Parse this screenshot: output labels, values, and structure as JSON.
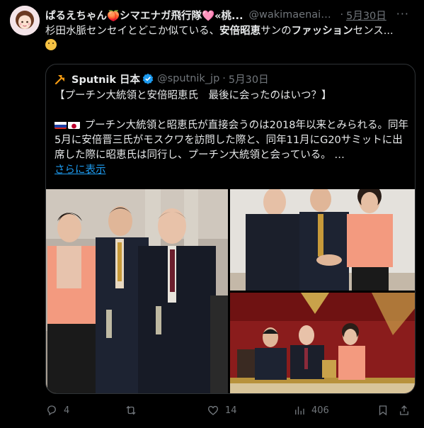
{
  "author": {
    "name": "ぱるえちゃん🍑シマエナガ飛行隊🩷«桃...",
    "handle": "@wakimaenaipa...",
    "separator": "·",
    "date": "5月30日"
  },
  "tweet": {
    "text_part1": "杉田水脈センセイとどこか似ている、",
    "text_bold1": "安倍昭恵",
    "text_part2": "サンの",
    "text_bold2": "ファッション",
    "text_part3": "センス...",
    "emoji": "thinking-face-emoji"
  },
  "quoted": {
    "name": "Sputnik 日本",
    "handle": "@sputnik_jp",
    "separator": "·",
    "date": "5月30日",
    "title": "【プーチン大統領と安倍昭恵氏　最後に会ったのはいつ？】",
    "body": "プーチン大統領と昭恵氏が直接会うのは2018年以来とみられる。同年5月に安倍晋三氏がモスクワを訪問した際と、同年11月にG20サミットに出席した際に昭恵氏は同行し、プーチン大統領と会っている。 …",
    "show_more": "さらに表示"
  },
  "actions": {
    "reply_count": "4",
    "like_count": "14",
    "view_count": "406"
  },
  "colors": {
    "background": "#000000",
    "text": "#e7e9ea",
    "muted": "#71767b",
    "link": "#1d9bf0",
    "border": "#2f3336",
    "verified": "#1d9bf0"
  }
}
